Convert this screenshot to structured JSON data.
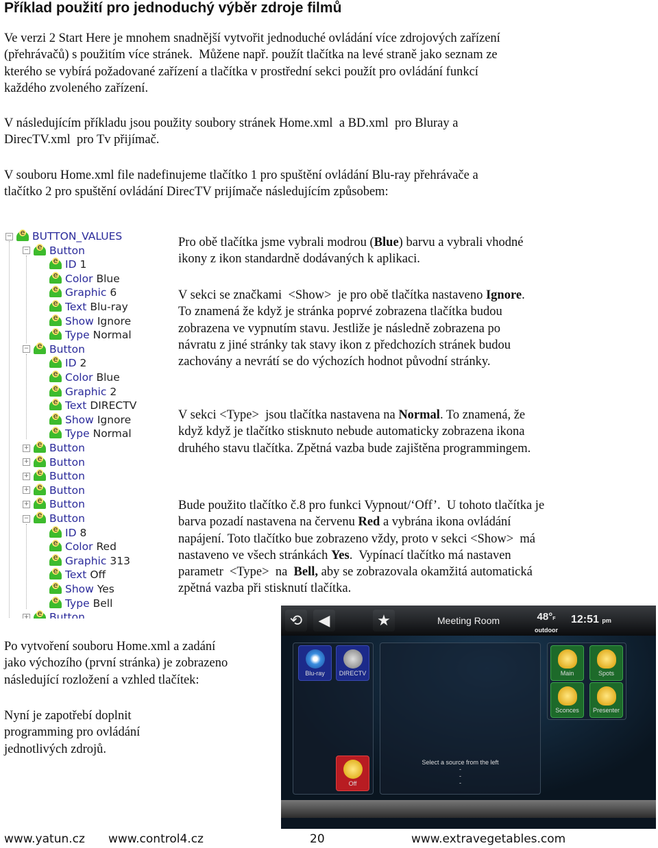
{
  "title": "Příklad použití pro jednoduchý výběr zdroje filmů",
  "paragraphs": [
    [
      [
        {
          "t": "Ve verzi 2 Start Here je mnohem snadnější vytvořit jednoduché ovládání více zdrojových zařízení"
        }
      ],
      [
        {
          "t": "(přehrávačů) s použitím více stránek.  Můžene např. použít tlačítka na levé straně jako seznam ze"
        }
      ],
      [
        {
          "t": "kterého se vybírá požadované zařízení a tlačítka v prostřední sekci použít pro ovládání funkcí"
        }
      ],
      [
        {
          "t": "každého zvoleného zařízení."
        }
      ]
    ],
    [
      [
        {
          "t": "V následujícím příkladu jsou použity soubory stránek Home.xml  a BD.xml  pro Bluray a"
        }
      ],
      [
        {
          "t": "DirecTV.xml  pro Tv přijímač."
        }
      ]
    ],
    [
      [
        {
          "t": "V souboru Home.xml file nadefinujeme tlačítko 1 pro spuštění ovládání Blu-ray přehrávače a"
        }
      ],
      [
        {
          "t": "tlačítko 2 pro spuštění ovládání DirecTV prijímače následujícím způsobem:"
        }
      ]
    ],
    [
      [
        {
          "t": "Pro obě tlačítka jsme vybrali modrou ("
        },
        {
          "t": "Blue",
          "b": true
        },
        {
          "t": ") barvu a vybrali vhodné"
        }
      ],
      [
        {
          "t": "ikony z ikon standardně dodávaných k aplikaci."
        }
      ]
    ],
    [
      [
        {
          "t": "V sekci se značkami  <Show>  je pro obě tlačítka nastaveno "
        },
        {
          "t": "Ignore",
          "b": true
        },
        {
          "t": "."
        }
      ],
      [
        {
          "t": "To znamená že když je stránka poprvé zobrazena tlačítka budou"
        }
      ],
      [
        {
          "t": "zobrazena ve vypnutím stavu. Jestliže je následně zobrazena po"
        }
      ],
      [
        {
          "t": "návratu z jiné stránky tak stavy ikon z předchozích stránek budou"
        }
      ],
      [
        {
          "t": "zachovány a nevrátí se do výchozích hodnot původní stránky."
        }
      ]
    ],
    [
      [
        {
          "t": "V sekci <Type>  jsou tlačítka nastavena na "
        },
        {
          "t": "Normal",
          "b": true
        },
        {
          "t": ". To znamená, že"
        }
      ],
      [
        {
          "t": "když když je tlačítko stisknuto nebude automaticky zobrazena ikona"
        }
      ],
      [
        {
          "t": "druhého stavu tlačítka. Zpětná vazba bude zajištěna programmingem."
        }
      ]
    ],
    [
      [
        {
          "t": "Bude použito tlačítko č.8 pro funkci Vypnout/‘Off’.  U tohoto tlačítka je"
        }
      ],
      [
        {
          "t": "barva pozadí nastavena na červenu "
        },
        {
          "t": "Red",
          "b": true
        },
        {
          "t": " a vybrána ikona ovládání"
        }
      ],
      [
        {
          "t": "napájení. Toto tlačítko bue zobrazeno vždy, proto v sekci <Show>  má"
        }
      ],
      [
        {
          "t": "nastaveno ve všech stránkách "
        },
        {
          "t": "Yes",
          "b": true
        },
        {
          "t": ".  Vypínací tlačítko má nastaven"
        }
      ],
      [
        {
          "t": "parametr  <Type>  na  "
        },
        {
          "t": "Bell,",
          "b": true
        },
        {
          "t": " aby se zobrazovala okamžitá automatická"
        }
      ],
      [
        {
          "t": "zpětná vazba při stisknutí tlačítka."
        }
      ]
    ],
    [
      [
        {
          "t": "Po vytvoření souboru Home.xml a zadání"
        }
      ],
      [
        {
          "t": "jako výchozího (první stránka) je zobrazeno"
        }
      ],
      [
        {
          "t": "následující rozložení a vzhled tlačítek:"
        }
      ]
    ],
    [
      [
        {
          "t": "Nyní je zapotřebí doplnit"
        }
      ],
      [
        {
          "t": "programming pro ovládání"
        }
      ],
      [
        {
          "t": "jednotlivých zdrojů."
        }
      ]
    ]
  ],
  "tree": [
    {
      "k": "BUTTON_VALUES",
      "v": "",
      "lvl": 0,
      "exp": "-"
    },
    {
      "k": "Button",
      "v": "",
      "lvl": 1,
      "exp": "-"
    },
    {
      "k": "ID",
      "v": "1",
      "lvl": 2
    },
    {
      "k": "Color",
      "v": "Blue",
      "lvl": 2
    },
    {
      "k": "Graphic",
      "v": "6",
      "lvl": 2
    },
    {
      "k": "Text",
      "v": "Blu-ray",
      "lvl": 2
    },
    {
      "k": "Show",
      "v": "Ignore",
      "lvl": 2
    },
    {
      "k": "Type",
      "v": "Normal",
      "lvl": 2
    },
    {
      "k": "Button",
      "v": "",
      "lvl": 1,
      "exp": "-"
    },
    {
      "k": "ID",
      "v": "2",
      "lvl": 2
    },
    {
      "k": "Color",
      "v": "Blue",
      "lvl": 2
    },
    {
      "k": "Graphic",
      "v": "2",
      "lvl": 2
    },
    {
      "k": "Text",
      "v": "DIRECTV",
      "lvl": 2
    },
    {
      "k": "Show",
      "v": "Ignore",
      "lvl": 2
    },
    {
      "k": "Type",
      "v": "Normal",
      "lvl": 2
    },
    {
      "k": "Button",
      "v": "",
      "lvl": 1,
      "exp": "+"
    },
    {
      "k": "Button",
      "v": "",
      "lvl": 1,
      "exp": "+"
    },
    {
      "k": "Button",
      "v": "",
      "lvl": 1,
      "exp": "+"
    },
    {
      "k": "Button",
      "v": "",
      "lvl": 1,
      "exp": "+"
    },
    {
      "k": "Button",
      "v": "",
      "lvl": 1,
      "exp": "+"
    },
    {
      "k": "Button",
      "v": "",
      "lvl": 1,
      "exp": "-"
    },
    {
      "k": "ID",
      "v": "8",
      "lvl": 2
    },
    {
      "k": "Color",
      "v": "Red",
      "lvl": 2
    },
    {
      "k": "Graphic",
      "v": "313",
      "lvl": 2
    },
    {
      "k": "Text",
      "v": "Off",
      "lvl": 2
    },
    {
      "k": "Show",
      "v": "Yes",
      "lvl": 2
    },
    {
      "k": "Type",
      "v": "Bell",
      "lvl": 2
    },
    {
      "k": "Button",
      "v": "",
      "lvl": 1,
      "exp": "+"
    }
  ],
  "screen": {
    "room": "Meeting Room",
    "temp": "48°",
    "temp_unit": "F",
    "temp_label": "outdoor",
    "time": "12:51",
    "ampm": "pm",
    "message": "Select a source from the left",
    "dashes": [
      "-",
      "-",
      "-"
    ],
    "sources": [
      {
        "label": "Blu-ray",
        "color": "#1c2a8a"
      },
      {
        "label": "DIRECTV",
        "color": "#1c2a8a"
      }
    ],
    "off": {
      "label": "Off",
      "color": "#b81c22"
    },
    "lights": [
      {
        "label": "Main"
      },
      {
        "label": "Spots"
      },
      {
        "label": "Sconces"
      },
      {
        "label": "Presenter"
      }
    ]
  },
  "footer": {
    "left": "www.yatun.cz",
    "mid": "www.control4.cz",
    "page": "20",
    "right": "www.extravegetables.com"
  }
}
